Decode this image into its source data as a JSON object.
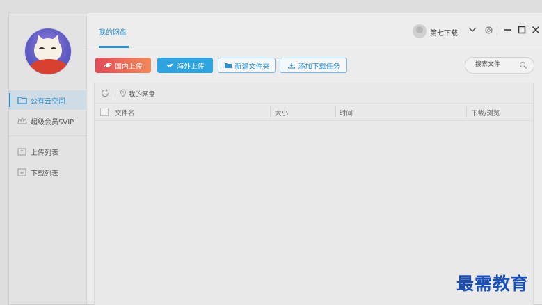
{
  "sidebar": {
    "items": [
      {
        "label": "公有云空间",
        "icon": "folder-icon"
      },
      {
        "label": "超级会员SVIP",
        "icon": "crown-icon"
      },
      {
        "label": "上传列表",
        "icon": "upload-list-icon"
      },
      {
        "label": "下载列表",
        "icon": "download-list-icon"
      }
    ]
  },
  "header": {
    "tab_label": "我的网盘",
    "user_name": "第七下载"
  },
  "toolbar": {
    "domestic_upload": "国内上传",
    "overseas_upload": "海外上传",
    "new_folder": "新建文件夹",
    "add_download_task": "添加下载任务",
    "search_placeholder": "搜索文件"
  },
  "file_panel": {
    "path": "我的网盘",
    "columns": [
      "文件名",
      "大小",
      "时间",
      "下载/浏览"
    ],
    "rows": []
  },
  "watermark": "最需教育",
  "colors": {
    "accent": "#2a8fd0",
    "upload_red": "#e24a5a",
    "upload_blue": "#2ea3df"
  }
}
